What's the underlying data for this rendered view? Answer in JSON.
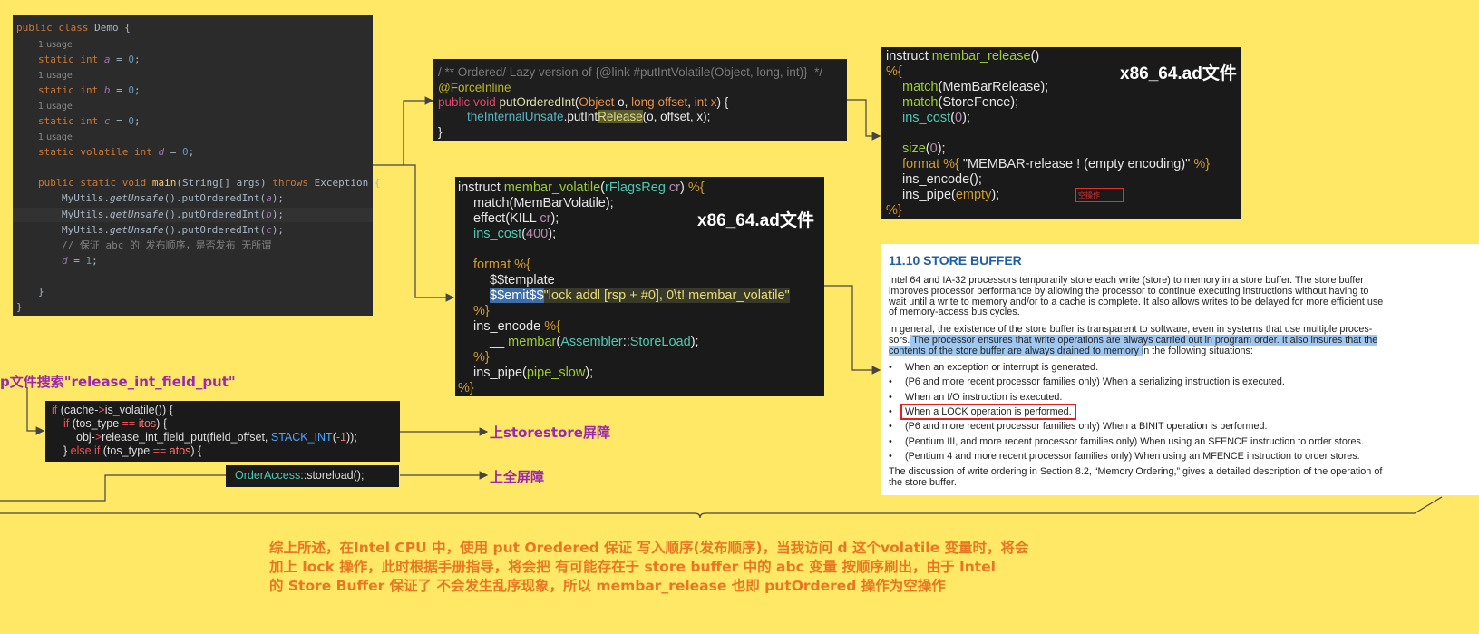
{
  "demo": {
    "class_line": [
      [
        "kw",
        "public class "
      ],
      [
        "",
        "Demo {"
      ]
    ],
    "usage": "1 usage",
    "fields": [
      {
        "pre": "static int ",
        "name": "a",
        "post": " = ",
        "val": "0",
        "end": ";"
      },
      {
        "pre": "static int ",
        "name": "b",
        "post": " = ",
        "val": "0",
        "end": ";"
      },
      {
        "pre": "static int ",
        "name": "c",
        "post": " = ",
        "val": "0",
        "end": ";"
      },
      {
        "pre": "static volatile int ",
        "name": "d",
        "post": " = ",
        "val": "0",
        "end": ";"
      }
    ],
    "main_kw": "public static void ",
    "main_name": "main",
    "main_args": "(String[] args) ",
    "main_throws": "throws",
    "main_exc": " Exception {",
    "calls": [
      "MyUtils.",
      "getUnsafe",
      "().putOrderedInt(",
      ");"
    ],
    "call_vars": [
      "a",
      "b",
      "c"
    ],
    "comment": "// 保证 abc 的 发布顺序，是否发布 无所谓",
    "assign_var": "d",
    "assign_rest": " = ",
    "assign_val": "1",
    "assign_end": ";",
    "close1": "}",
    "close2": "}"
  },
  "unsafe": {
    "comment": "/ ** Ordered/ Lazy version of {@link #putIntVolatile(Object, long, int)}  */",
    "annotation": "@ForceInline",
    "sig_kw": "public void ",
    "sig_name": "putOrderedInt",
    "sig_args": [
      [
        "org",
        "Object "
      ],
      [
        "wht",
        "o"
      ],
      [
        "wht",
        ", "
      ],
      [
        "org",
        "long "
      ],
      [
        "org",
        "offset"
      ],
      [
        "wht",
        ", "
      ],
      [
        "org",
        "int "
      ],
      [
        "org",
        "x"
      ],
      [
        "wht",
        ") {"
      ]
    ],
    "body_obj": "theInternalUnsafe",
    "body_mid": ".putInt",
    "body_rel": "Release",
    "body_end": "(o, offset, x);",
    "close": "}"
  },
  "volatile_panel": {
    "label": "x86_64.ad文件",
    "l1": [
      [
        "lg",
        "instruct "
      ],
      [
        "grn",
        "membar_volatile"
      ],
      [
        "lg",
        "("
      ],
      [
        "cy2",
        "rFlagsReg "
      ],
      [
        "pur",
        "cr"
      ],
      [
        "lg",
        ") "
      ],
      [
        "gold",
        "%{"
      ]
    ],
    "l2": [
      [
        "lg",
        "match(MemBarVolatile);"
      ]
    ],
    "l3": [
      [
        "lg",
        "effect(KILL "
      ],
      [
        "pur",
        "cr"
      ],
      [
        "lg",
        ");"
      ]
    ],
    "l4": [
      [
        "cy2",
        "ins_cost"
      ],
      [
        "lg",
        "("
      ],
      [
        "pur",
        "400"
      ],
      [
        "lg",
        ");"
      ]
    ],
    "l5": [
      [
        "gold",
        "format "
      ],
      [
        "gold",
        "%{"
      ]
    ],
    "l6": [
      [
        "lg",
        "$$template"
      ]
    ],
    "l7_sel": "$$emit$$",
    "l7_str": "\"lock addl [rsp + #0], 0\\t! membar_volatile\"",
    "l8": [
      [
        "gold",
        "%}"
      ]
    ],
    "l9": [
      [
        "lg",
        "ins_encode "
      ],
      [
        "gold",
        "%{"
      ]
    ],
    "l10": [
      [
        "lg",
        "__ "
      ],
      [
        "grn",
        "membar"
      ],
      [
        "lg",
        "("
      ],
      [
        "cy2",
        "Assembler"
      ],
      [
        "lg",
        "::"
      ],
      [
        "cy2",
        "StoreLoad"
      ],
      [
        "lg",
        ");"
      ]
    ],
    "l11": [
      [
        "gold",
        "%}"
      ]
    ],
    "l12": [
      [
        "lg",
        "ins_pipe("
      ],
      [
        "grn",
        "pipe_slow"
      ],
      [
        "lg",
        ");"
      ]
    ],
    "l13": [
      [
        "gold",
        "%}"
      ]
    ]
  },
  "release_panel": {
    "label": "x86_64.ad文件",
    "l1": [
      [
        "lg",
        "instruct "
      ],
      [
        "grn",
        "membar_release"
      ],
      [
        "lg",
        "()"
      ]
    ],
    "l2": [
      [
        "gold",
        "%{"
      ]
    ],
    "l3": [
      [
        "grn",
        "match"
      ],
      [
        "lg",
        "(MemBarRelease);"
      ]
    ],
    "l4": [
      [
        "grn",
        "match"
      ],
      [
        "lg",
        "(StoreFence);"
      ]
    ],
    "l5": [
      [
        "cy2",
        "ins_cost"
      ],
      [
        "lg",
        "("
      ],
      [
        "pur",
        "0"
      ],
      [
        "lg",
        ");"
      ]
    ],
    "l6": [
      [
        "grn",
        "size"
      ],
      [
        "lg",
        "("
      ],
      [
        "pur",
        "0"
      ],
      [
        "lg",
        ");"
      ]
    ],
    "l7": [
      [
        "gold",
        "format "
      ],
      [
        "gold",
        "%{ "
      ],
      [
        "lg",
        "\"MEMBAR-release ! (empty encoding)\" "
      ],
      [
        "gold",
        "%}"
      ]
    ],
    "l8": [
      [
        "lg",
        "ins_encode();"
      ]
    ],
    "l9": [
      [
        "lg",
        "ins_pipe("
      ],
      [
        "gold",
        "empty"
      ],
      [
        "lg",
        ");"
      ]
    ],
    "l10": [
      [
        "gold",
        "%}"
      ]
    ],
    "empty_tag": "空操作"
  },
  "cpp": {
    "search_label": "p文件搜索\"release_int_field_put\"",
    "l1": [
      [
        "cppr",
        "if "
      ],
      [
        "cppv",
        "(cache-"
      ],
      [
        "cppr",
        ">"
      ],
      [
        "cppv",
        "is_volatile()) {"
      ]
    ],
    "l2": [
      [
        "cppr",
        "if "
      ],
      [
        "cppv",
        "(tos_type "
      ],
      [
        "cppr",
        "== "
      ],
      [
        "cppn",
        "itos"
      ],
      [
        "cppv",
        ") {"
      ]
    ],
    "l3": [
      [
        "cppv",
        "obj-"
      ],
      [
        "cppr",
        ">"
      ],
      [
        "cppv",
        "release_int_field_put(field_offset, "
      ],
      [
        "cppblue",
        "STACK_INT"
      ],
      [
        "cppv",
        "("
      ],
      [
        "cppn",
        "-1"
      ],
      [
        "cppv",
        "));"
      ]
    ],
    "l4": [
      [
        "cppv",
        "} "
      ],
      [
        "cppr",
        "else if "
      ],
      [
        "cppv",
        "(tos_type "
      ],
      [
        "cppr",
        "== "
      ],
      [
        "cppn",
        "atos"
      ],
      [
        "cppv",
        ") {"
      ]
    ],
    "storeload": [
      [
        "cy2",
        "OrderAccess"
      ],
      [
        "cppv",
        "::storeload();"
      ]
    ],
    "label_storestore": "上storestore屏障",
    "label_full": "上全屏障"
  },
  "doc": {
    "heading": "11.10    STORE BUFFER",
    "p1": [
      "Intel 64 and IA-32 processors temporarily store each write (store) to memory in a store buffer. The store buffer",
      "improves processor performance by allowing the processor to continue executing instructions without having to",
      "wait until a write to memory and/or to a cache is complete. It also allows writes to be delayed for more efficient use",
      "of memory-access bus cycles."
    ],
    "p2_l1": "In general, the existence of the store buffer is transparent to software, even in systems that use multiple proces-",
    "p2_l2a": "sors.",
    "p2_l2b": " The processor ensures that write operations are always carried out in program order. It also insures that the",
    "p2_l3a": "contents of the store buffer are always drained to memory i",
    "p2_l3b": "n the following situations:",
    "bullets": [
      "When an exception or interrupt is generated.",
      "(P6 and more recent processor families only) When a serializing instruction is executed.",
      "When an I/O instruction is executed.",
      "When a LOCK operation is performed.",
      "(P6 and more recent processor families only) When a BINIT operation is performed.",
      "(Pentium III, and more recent processor families only) When using an SFENCE instruction to order stores.",
      "(Pentium 4 and more recent processor families only) When using an MFENCE instruction to order stores."
    ],
    "p3": [
      "The discussion of write ordering in Section 8.2, “Memory Ordering,” gives a detailed description of the operation of",
      "the store buffer."
    ]
  },
  "summary": [
    "综上所述，在Intel CPU 中，使用 put Oredered 保证 写入顺序(发布顺序)，当我访问 d 这个volatile 变量时，将会",
    "加上 lock 操作，此时根据手册指导，将会把 有可能存在于 store buffer 中的 abc 变量 按顺序刷出，由于 Intel",
    "的 Store Buffer 保证了 不会发生乱序现象，所以 membar_release 也即 putOrdered 操作为空操作"
  ],
  "colors": {
    "background": "#ffe866",
    "summary": "#e87722",
    "label": "#9c27b0",
    "arrow": "#444444",
    "empty_arrow": "#e03030"
  }
}
